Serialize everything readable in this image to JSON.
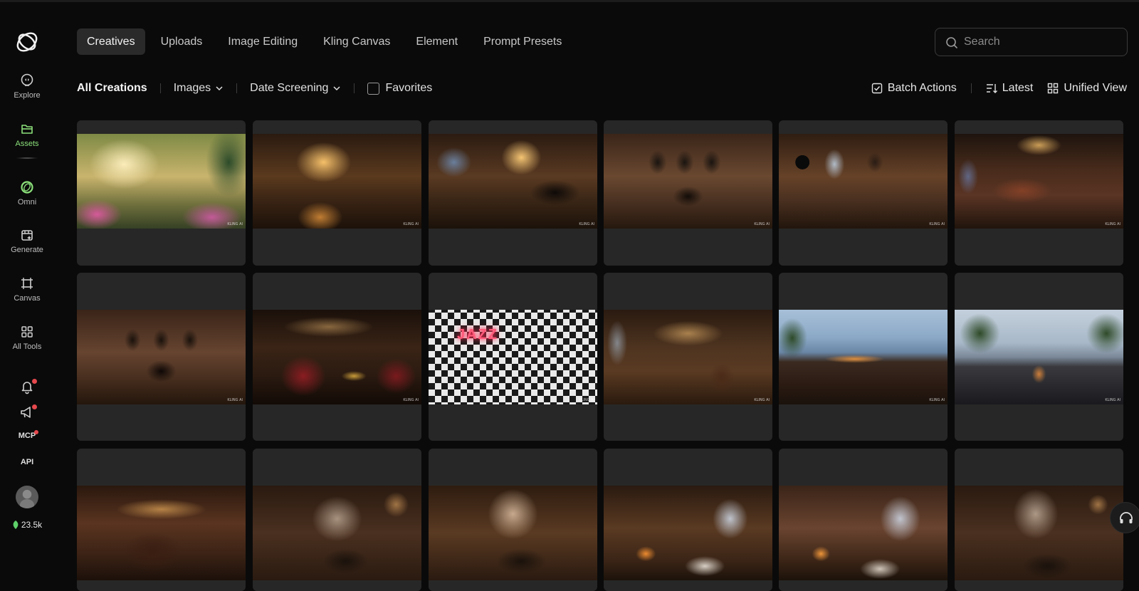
{
  "sidebar": {
    "nav": [
      {
        "label": "Explore",
        "icon": "explore-icon"
      },
      {
        "label": "Assets",
        "icon": "folder-icon",
        "active": true
      },
      {
        "label": "Omni",
        "icon": "omni-icon"
      },
      {
        "label": "Generate",
        "icon": "generate-icon"
      },
      {
        "label": "Canvas",
        "icon": "canvas-icon"
      },
      {
        "label": "All Tools",
        "icon": "grid-icon"
      }
    ],
    "mcp_label": "MCP",
    "api_label": "API",
    "credits": "23.5k",
    "accent_color": "#8be07a",
    "notification_color": "#e5484d"
  },
  "header": {
    "tabs": [
      {
        "label": "Creatives",
        "active": true
      },
      {
        "label": "Uploads"
      },
      {
        "label": "Image Editing"
      },
      {
        "label": "Kling Canvas"
      },
      {
        "label": "Element"
      },
      {
        "label": "Prompt Presets"
      }
    ],
    "search_placeholder": "Search"
  },
  "filters": {
    "title": "All Creations",
    "type_dropdown": "Images",
    "date_dropdown": "Date Screening",
    "favorites_label": "Favorites",
    "favorites_checked": false,
    "batch_actions": "Batch Actions",
    "sort": "Latest",
    "view": "Unified View"
  },
  "grid": {
    "watermark": "KLING AI",
    "images": [
      {
        "style": "s0",
        "scene": "sunlit garden conservatory with piano and pink flowers"
      },
      {
        "style": "s1",
        "scene": "warm lit cafe interior with upright piano"
      },
      {
        "style": "s2",
        "scene": "brick cafe with grand piano"
      },
      {
        "style": "s3",
        "scene": "jazz club with saxophone posters and piano"
      },
      {
        "style": "s4",
        "scene": "brick bar with vinyl record and posters"
      },
      {
        "style": "s5",
        "scene": "long restaurant hall with chandeliers"
      },
      {
        "style": "s6",
        "scene": "jazz club with three posters and piano"
      },
      {
        "style": "s7",
        "scene": "red velvet chairs with saxophone at bar"
      },
      {
        "style": "s8",
        "scene": "neon JAZZ diner with checkered floor",
        "neon": "JAZZ"
      },
      {
        "style": "s9",
        "scene": "cafe with hanging bulbs and leather armchair"
      },
      {
        "style": "s10",
        "scene": "rooftop bar overlooking city skyline"
      },
      {
        "style": "s11",
        "scene": "glass cafe with city view and greenery"
      },
      {
        "style": "s12",
        "scene": "dark restaurant with chandeliers"
      },
      {
        "style": "s13",
        "scene": "steaming coffee cup close-up"
      },
      {
        "style": "s14",
        "scene": "steaming coffee cup in warm light"
      },
      {
        "style": "s15",
        "scene": "fireplace lounge with snowy window"
      },
      {
        "style": "s16",
        "scene": "brick fireplace lounge with snowy window"
      },
      {
        "style": "s17",
        "scene": "steaming coffee cup with bokeh"
      }
    ]
  }
}
